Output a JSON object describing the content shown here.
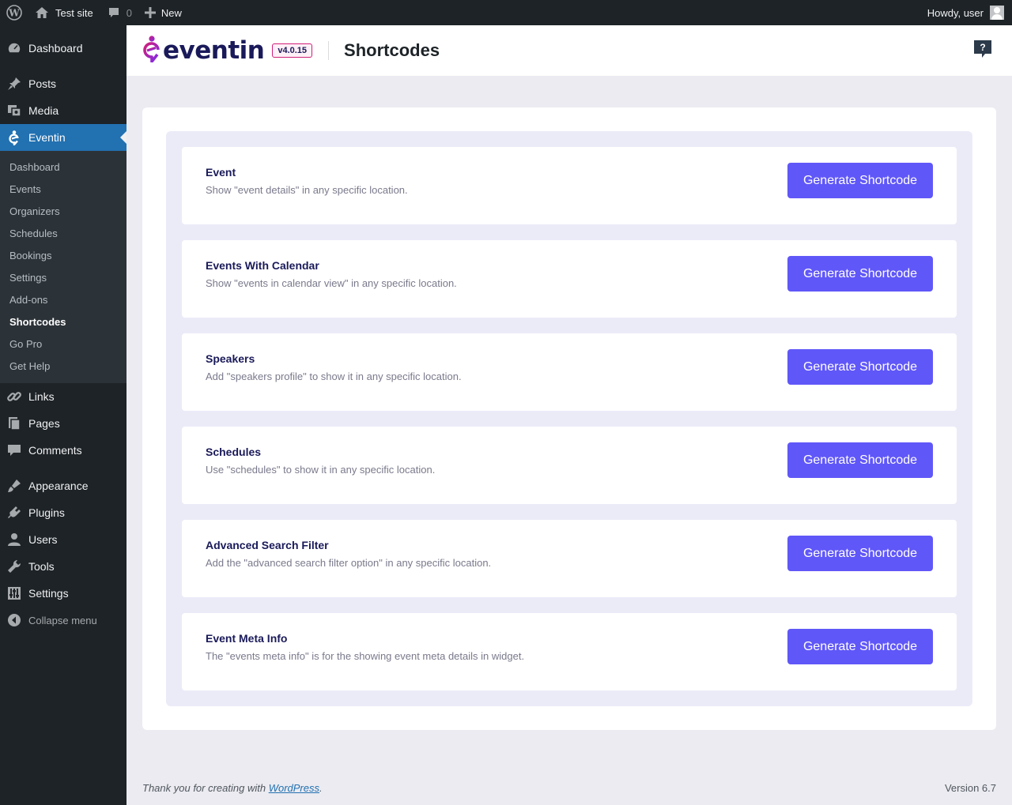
{
  "admin_bar": {
    "site_name": "Test site",
    "comments_count": "0",
    "new_label": "New",
    "howdy": "Howdy, user"
  },
  "sidebar": {
    "items_top": [
      {
        "label": "Dashboard",
        "icon": "dashboard-icon"
      }
    ],
    "items_content": [
      {
        "label": "Posts",
        "icon": "pin-icon"
      },
      {
        "label": "Media",
        "icon": "media-icon"
      }
    ],
    "current": {
      "label": "Eventin",
      "icon": "eventin-icon"
    },
    "submenu": [
      {
        "label": "Dashboard"
      },
      {
        "label": "Events"
      },
      {
        "label": "Organizers"
      },
      {
        "label": "Schedules"
      },
      {
        "label": "Bookings"
      },
      {
        "label": "Settings"
      },
      {
        "label": "Add-ons"
      },
      {
        "label": "Shortcodes",
        "active": true
      },
      {
        "label": "Go Pro"
      },
      {
        "label": "Get Help"
      }
    ],
    "items_after": [
      {
        "label": "Links",
        "icon": "link-icon"
      },
      {
        "label": "Pages",
        "icon": "pages-icon"
      },
      {
        "label": "Comments",
        "icon": "comment-icon"
      }
    ],
    "items_admin": [
      {
        "label": "Appearance",
        "icon": "brush-icon"
      },
      {
        "label": "Plugins",
        "icon": "plugin-icon"
      },
      {
        "label": "Users",
        "icon": "user-icon"
      },
      {
        "label": "Tools",
        "icon": "wrench-icon"
      },
      {
        "label": "Settings",
        "icon": "settings-icon"
      }
    ],
    "collapse_label": "Collapse menu"
  },
  "header": {
    "logo_text": "eventin",
    "version": "v4.0.15",
    "title": "Shortcodes",
    "help_icon": "help-chat-icon"
  },
  "shortcodes": [
    {
      "title": "Event",
      "description": "Show \"event details\" in any specific location.",
      "button": "Generate Shortcode"
    },
    {
      "title": "Events With Calendar",
      "description": "Show \"events in calendar view\" in any specific location.",
      "button": "Generate Shortcode"
    },
    {
      "title": "Speakers",
      "description": "Add \"speakers profile\" to show it in any specific location.",
      "button": "Generate Shortcode"
    },
    {
      "title": "Schedules",
      "description": "Use \"schedules\" to show it in any specific location.",
      "button": "Generate Shortcode"
    },
    {
      "title": "Advanced Search Filter",
      "description": "Add the \"advanced search filter option\" in any specific location.",
      "button": "Generate Shortcode"
    },
    {
      "title": "Event Meta Info",
      "description": "The \"events meta info\" is for the showing event meta details in widget.",
      "button": "Generate Shortcode"
    }
  ],
  "footer": {
    "thanks_prefix": "Thank you for creating with ",
    "thanks_link": "WordPress",
    "thanks_suffix": ".",
    "version": "Version 6.7"
  },
  "colors": {
    "accent": "#6057f8",
    "admin_bg": "#1d2327",
    "current_menu": "#2271b1",
    "brand_pink": "#d11f78"
  }
}
